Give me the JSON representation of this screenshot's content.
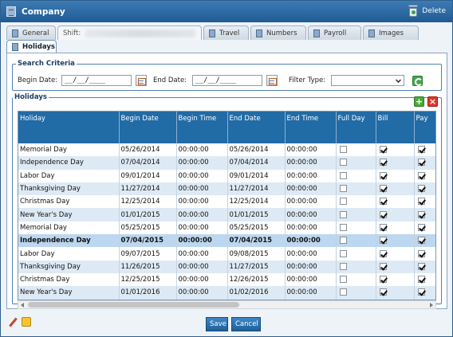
{
  "window": {
    "title": "Company",
    "delete_label": "Delete"
  },
  "tabs": {
    "general": "General",
    "shift": "Shift:",
    "travel": "Travel",
    "numbers": "Numbers",
    "payroll": "Payroll",
    "images": "Images",
    "holidays": "Holidays"
  },
  "criteria": {
    "legend": "Search Criteria",
    "begin_label": "Begin Date:",
    "begin_value": "__/__/____",
    "end_label": "End Date:",
    "end_value": "__/__/____",
    "filter_label": "Filter Type:",
    "filter_value": ""
  },
  "holidays": {
    "legend": "Holidays",
    "columns": [
      "Holiday",
      "Begin Date",
      "Begin Time",
      "End Date",
      "End Time",
      "Full Day",
      "Bill",
      "Pay"
    ],
    "rows": [
      {
        "holiday": "Memorial Day",
        "begin_date": "05/26/2014",
        "begin_time": "00:00:00",
        "end_date": "05/26/2014",
        "end_time": "00:00:00",
        "full_day": false,
        "bill": true,
        "pay": true
      },
      {
        "holiday": "Independence Day",
        "begin_date": "07/04/2014",
        "begin_time": "00:00:00",
        "end_date": "07/04/2014",
        "end_time": "00:00:00",
        "full_day": false,
        "bill": true,
        "pay": true
      },
      {
        "holiday": "Labor Day",
        "begin_date": "09/01/2014",
        "begin_time": "00:00:00",
        "end_date": "09/01/2014",
        "end_time": "00:00:00",
        "full_day": false,
        "bill": true,
        "pay": true
      },
      {
        "holiday": "Thanksgiving Day",
        "begin_date": "11/27/2014",
        "begin_time": "00:00:00",
        "end_date": "11/27/2014",
        "end_time": "00:00:00",
        "full_day": false,
        "bill": true,
        "pay": true
      },
      {
        "holiday": "Christmas Day",
        "begin_date": "12/25/2014",
        "begin_time": "00:00:00",
        "end_date": "12/25/2014",
        "end_time": "00:00:00",
        "full_day": false,
        "bill": true,
        "pay": true
      },
      {
        "holiday": "New Year's Day",
        "begin_date": "01/01/2015",
        "begin_time": "00:00:00",
        "end_date": "01/01/2015",
        "end_time": "00:00:00",
        "full_day": false,
        "bill": true,
        "pay": true
      },
      {
        "holiday": "Memorial Day",
        "begin_date": "05/25/2015",
        "begin_time": "00:00:00",
        "end_date": "05/25/2015",
        "end_time": "00:00:00",
        "full_day": false,
        "bill": true,
        "pay": true
      },
      {
        "holiday": "Independence Day",
        "begin_date": "07/04/2015",
        "begin_time": "00:00:00",
        "end_date": "07/04/2015",
        "end_time": "00:00:00",
        "full_day": false,
        "bill": true,
        "pay": true,
        "selected": true
      },
      {
        "holiday": "Labor Day",
        "begin_date": "09/07/2015",
        "begin_time": "00:00:00",
        "end_date": "09/08/2015",
        "end_time": "00:00:00",
        "full_day": false,
        "bill": true,
        "pay": true
      },
      {
        "holiday": "Thanksgiving Day",
        "begin_date": "11/26/2015",
        "begin_time": "00:00:00",
        "end_date": "11/27/2015",
        "end_time": "00:00:00",
        "full_day": false,
        "bill": true,
        "pay": true
      },
      {
        "holiday": "Christmas Day",
        "begin_date": "12/25/2015",
        "begin_time": "00:00:00",
        "end_date": "12/26/2015",
        "end_time": "00:00:00",
        "full_day": false,
        "bill": true,
        "pay": true
      },
      {
        "holiday": "New Year's Day",
        "begin_date": "01/01/2016",
        "begin_time": "00:00:00",
        "end_date": "01/02/2016",
        "end_time": "00:00:00",
        "full_day": false,
        "bill": true,
        "pay": true
      }
    ]
  },
  "footer": {
    "save_label": "Save",
    "cancel_label": "Cancel"
  },
  "colors": {
    "titlebar": "#205a93",
    "header": "#216ba6",
    "row_alt": "#ddeaf5",
    "row_selected": "#bcd7ef",
    "button": "#1e5f9a"
  }
}
